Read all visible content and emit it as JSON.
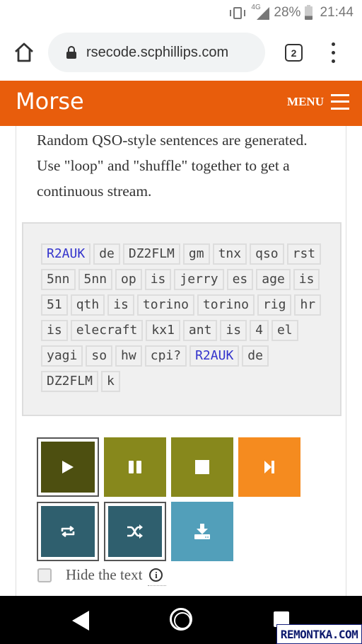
{
  "status_bar": {
    "network": "4G",
    "battery": "28%",
    "battery_level": 0.28,
    "time": "21:44",
    "icons": [
      "vibrate-icon",
      "signal-icon",
      "battery-icon"
    ]
  },
  "browser": {
    "url": "rsecode.scphillips.com",
    "tab_count": "2",
    "icons": [
      "home-icon",
      "lock-icon",
      "more-vert-icon"
    ]
  },
  "site_header": {
    "title": "Morse",
    "menu_label": "MENU",
    "color": "#e85d0c"
  },
  "intro_text": "Random QSO-style sentences are generated. Use \"loop\" and \"shuffle\" together to get a continuous stream.",
  "words": [
    {
      "text": "R2AUK",
      "callsign": true
    },
    {
      "text": "de"
    },
    {
      "text": "DZ2FLM"
    },
    {
      "text": "gm"
    },
    {
      "text": "tnx"
    },
    {
      "text": "qso"
    },
    {
      "text": "rst"
    },
    {
      "text": "5nn"
    },
    {
      "text": "5nn"
    },
    {
      "text": "op"
    },
    {
      "text": "is"
    },
    {
      "text": "jerry"
    },
    {
      "text": "es"
    },
    {
      "text": "age"
    },
    {
      "text": "is"
    },
    {
      "text": "51"
    },
    {
      "text": "qth"
    },
    {
      "text": "is"
    },
    {
      "text": "torino"
    },
    {
      "text": "torino"
    },
    {
      "text": "rig"
    },
    {
      "text": "hr"
    },
    {
      "text": "is"
    },
    {
      "text": "elecraft"
    },
    {
      "text": "kx1"
    },
    {
      "text": "ant"
    },
    {
      "text": "is"
    },
    {
      "text": "4"
    },
    {
      "text": "el"
    },
    {
      "text": "yagi"
    },
    {
      "text": "so"
    },
    {
      "text": "hw"
    },
    {
      "text": "cpi?"
    },
    {
      "text": "R2AUK",
      "callsign": true
    },
    {
      "text": "de"
    },
    {
      "text": "DZ2FLM"
    },
    {
      "text": "k"
    }
  ],
  "controls": {
    "play": {
      "icon": "play-icon",
      "color": "#4d4f10",
      "active": true
    },
    "pause": {
      "icon": "pause-icon",
      "color": "#87881c"
    },
    "stop": {
      "icon": "stop-icon",
      "color": "#87881c"
    },
    "next": {
      "icon": "skip-next-icon",
      "color": "#f58b1f"
    },
    "loop": {
      "icon": "loop-icon",
      "color": "#2f5f6e",
      "active": true
    },
    "shuffle": {
      "icon": "shuffle-icon",
      "color": "#2f5f6e",
      "active": true
    },
    "download": {
      "icon": "download-icon",
      "color": "#529fba"
    }
  },
  "hide_text": {
    "label": "Hide the text",
    "checked": false,
    "info_glyph": "i"
  },
  "watermark": "REMONTKA.COM"
}
